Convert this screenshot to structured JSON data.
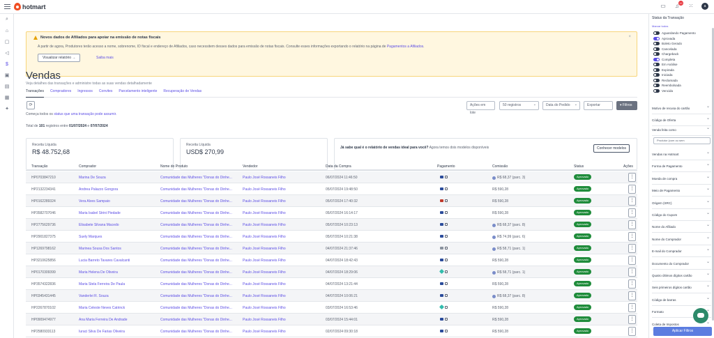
{
  "app": {
    "brand": "hotmart",
    "notification_count": "12",
    "avatar_letter": "a"
  },
  "alert": {
    "title": "Novos dados de Afiliados para apoiar na emissão de notas fiscais",
    "body": "A partir de agora, Produtores terão acesso a nome, sobrenome, ID fiscal e endereço de Afiliados, caso necessitem desses dados para emissão de notas fiscais. Consulte esses informações exportando o relatório na página de",
    "body_link": "Pagamentos a Afiliados",
    "view_button": "Visualizar relatório →",
    "learn_more": "Saiba mais",
    "close": "×"
  },
  "page": {
    "title": "Vendas",
    "subtitle": "Veja detalhes das transações e administre todas as suas vendas detalhadamente",
    "tabs": [
      "Transações",
      "Compradores",
      "Ingressos",
      "Convites",
      "Parcelamento inteligente",
      "Recuperação de Vendas"
    ]
  },
  "toolbar": {
    "note_prefix": "Começa todos os",
    "note_link": "status que uma transação pode assumir.",
    "bulk_actions": "Ações em lote",
    "page_size": "50 registros",
    "order_by": "Data do Pedido",
    "export": "Exportar",
    "filters": "Filtros"
  },
  "summary": {
    "total_prefix": "Total de",
    "total_count": "101",
    "total_suffix": "registros entre",
    "date_from": "01/07/2024",
    "and": "e",
    "date_to": "07/07/2024",
    "cards": [
      {
        "label": "Receita Líquida",
        "value": "R$ 48.752,68"
      },
      {
        "label": "Receita Líquida",
        "value": "USD$ 270,99"
      }
    ],
    "report_question": "Já sabe qual é o relatório de vendas ideal para você?",
    "report_text": "Agora temos dois modelos disponíveis",
    "report_button": "Conhecer modelos"
  },
  "table": {
    "columns": [
      "Transação",
      "Comprador",
      "Nome do Produto",
      "Vendedor",
      "Data da Compra",
      "Pagamento",
      "Comissão",
      "Status",
      "Ações"
    ],
    "rows": [
      {
        "id": "HP0703847210",
        "buyer": "Marina De Souza",
        "product": "Comunidade das Mulheres \"Donas do Dinhe...",
        "seller": "Paulo José Rossaneis Filho",
        "date": "06/07/2024 11:46:50",
        "pay": "card",
        "commission": "R$ 68,37 (parc. 3)",
        "coin": true,
        "status": "Aprovado"
      },
      {
        "id": "HP2132234341",
        "buyer": "Andrea Palazzo Gongora",
        "product": "Comunidade das Mulheres \"Donas do Dinhe...",
        "seller": "Paulo José Rossaneis Filho",
        "date": "05/07/2024 19:48:50",
        "pay": "card",
        "commission": "R$ 590,28",
        "coin": false,
        "status": "Aprovado"
      },
      {
        "id": "HP0162289324",
        "buyer": "Vera Alves Sampaio",
        "product": "Comunidade das Mulheres \"Donas do Dinhe...",
        "seller": "Paulo José Rossaneis Filho",
        "date": "05/07/2024 17:40:32",
        "pay": "red",
        "commission": "R$ 590,28",
        "coin": false,
        "status": "Aprovado"
      },
      {
        "id": "HP3582707046",
        "buyer": "Maria Isabel Strini Piedade",
        "product": "Comunidade das Mulheres \"Donas do Dinhe...",
        "seller": "Paulo José Rossaneis Filho",
        "date": "05/07/2024 16:14:17",
        "pay": "card",
        "commission": "R$ 590,28",
        "coin": false,
        "status": "Aprovado"
      },
      {
        "id": "HP2775629736",
        "buyer": "Elisabete Silvana Macedo",
        "product": "Comunidade das Mulheres \"Donas do Dinhe...",
        "seller": "Paulo José Rossaneis Filho",
        "date": "05/07/2024 10:23:13",
        "pay": "card",
        "commission": "R$ 68,37 (parc. 8)",
        "coin": true,
        "status": "Aprovado"
      },
      {
        "id": "HP2901827375",
        "buyer": "Suely Marques",
        "product": "Comunidade das Mulheres \"Donas do Dinhe...",
        "seller": "Paulo José Rossaneis Filho",
        "date": "05/07/2024 10:21:38",
        "pay": "card",
        "commission": "R$ 74,99 (parc. 6)",
        "coin": true,
        "status": "Aprovado"
      },
      {
        "id": "HP1269798162",
        "buyer": "Marinea Sousa Dos Santos",
        "product": "Comunidade das Mulheres \"Donas do Dinhe...",
        "seller": "Paulo José Rossaneis Filho",
        "date": "04/07/2024 21:37:46",
        "pay": "gray",
        "commission": "R$ 58,71 (parc. 1)",
        "coin": true,
        "status": "Aprovado"
      },
      {
        "id": "HP3210625856",
        "buyer": "Lucia Barreto Tavares Cavalcanti",
        "product": "Comunidade das Mulheres \"Donas do Dinhe...",
        "seller": "Paulo José Rossaneis Filho",
        "date": "04/07/2024 18:42:43",
        "pay": "card",
        "commission": "R$ 590,28",
        "coin": false,
        "status": "Aprovado"
      },
      {
        "id": "HP0170309399",
        "buyer": "Maria Helena De Oliveira",
        "product": "Comunidade das Mulheres \"Donas do Dinhe...",
        "seller": "Paulo José Rossaneis Filho",
        "date": "04/07/2024 18:29:06",
        "pay": "pix",
        "commission": "R$ 58,71 (parc. 1)",
        "coin": true,
        "status": "Aprovado"
      },
      {
        "id": "HP3574322836",
        "buyer": "Maria Stela Ferreira De Paula",
        "product": "Comunidade das Mulheres \"Donas do Dinhe...",
        "seller": "Paulo José Rossaneis Filho",
        "date": "04/07/2024 13:21:44",
        "pay": "card",
        "commission": "R$ 590,28",
        "coin": false,
        "status": "Aprovado"
      },
      {
        "id": "HP0345431445",
        "buyer": "Vanderlei R. Souza",
        "product": "Comunidade das Mulheres \"Donas do Dinhe...",
        "seller": "Paulo José Rossaneis Filho",
        "date": "04/07/2024 10:06:21",
        "pay": "card",
        "commission": "R$ 68,37 (parc. 8)",
        "coin": true,
        "status": "Aprovado"
      },
      {
        "id": "HP2267870102",
        "buyer": "Maria Celeste Neves Catrinck",
        "product": "Comunidade das Mulheres \"Donas do Dinhe...",
        "seller": "Paulo José Rossaneis Filho",
        "date": "03/07/2024 16:53:46",
        "pay": "pix",
        "commission": "R$ 590,28",
        "coin": false,
        "status": "Aprovado"
      },
      {
        "id": "HP0909474977",
        "buyer": "Ana Maria Ferreira De Andrade",
        "product": "Comunidade das Mulheres \"Donas do Dinhe...",
        "seller": "Paulo José Rossaneis Filho",
        "date": "03/07/2024 15:44:01",
        "pay": "card",
        "commission": "R$ 590,28",
        "coin": false,
        "status": "Aprovado"
      },
      {
        "id": "HP2580933113",
        "buyer": "Iuraci Silva De Farias Oliveira",
        "product": "Comunidade das Mulheres \"Donas do Dinhe...",
        "seller": "Paulo José Rossaneis Filho",
        "date": "02/07/2024 09:30:18",
        "pay": "card",
        "commission": "R$ 590,28",
        "coin": false,
        "status": "Aprovado"
      }
    ],
    "actions_glyph": "⋮"
  },
  "filters": {
    "status_title": "Status da Transação",
    "mark_all": "Marcar todos",
    "status_options": [
      {
        "label": "Aguardando Pagamento",
        "on": false
      },
      {
        "label": "Aprovada",
        "on": true
      },
      {
        "label": "Boleto Gerado",
        "on": false
      },
      {
        "label": "Cancelada",
        "on": false
      },
      {
        "label": "Chargeback",
        "on": false
      },
      {
        "label": "Completa",
        "on": true
      },
      {
        "label": "Em Análise",
        "on": false
      },
      {
        "label": "Expirada",
        "on": false
      },
      {
        "label": "Iniciada",
        "on": false
      },
      {
        "label": "Reclamada",
        "on": false
      },
      {
        "label": "Reembolsada",
        "on": false
      },
      {
        "label": "Vencida",
        "on": false
      }
    ],
    "sections_a": [
      "Motivo de recusa do cartão",
      "Código de Oferta"
    ],
    "sale_made_as": "Venda feita como",
    "sale_made_as_value": "Produtor (com ou sem",
    "sections_b": [
      "Vendas na Hotmart",
      "Forma de Pagamento",
      "Moeda de compra",
      "Meio de Pagamento",
      "Origem (SRC)",
      "Código do Cupom",
      "Nome do Afiliado",
      "Nome do Comprador",
      "E-mail do Comprador",
      "Documento do Comprador",
      "Quatro últimos dígitos cartão",
      "Seis primeiros dígitos cartão",
      "Código de barras",
      "Formato",
      "Coleta de Impostos"
    ],
    "apply": "Aplicar Filtros"
  }
}
